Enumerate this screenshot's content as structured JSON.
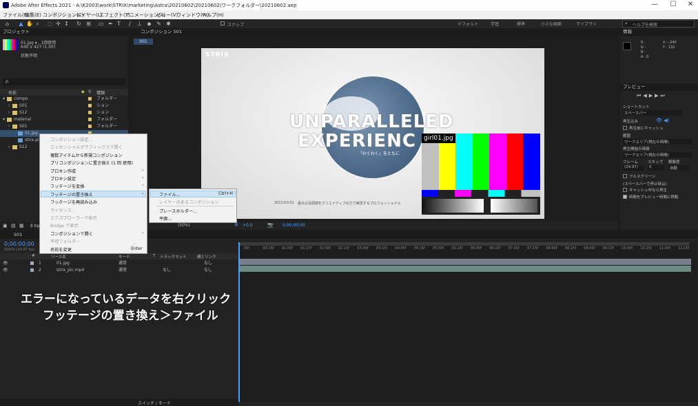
{
  "app": {
    "title": "Adobe After Effects 2021 - A:\\K2003\\work\\STRIX\\marketing\\Astra\\20210602\\20210602\\ワークフォルダー\\20210602.aep"
  },
  "window_controls": {
    "minimize": "—",
    "maximize": "☐",
    "close": "✕"
  },
  "menubar": [
    "ファイル(F)",
    "編集(E)",
    "コンポジション(C)",
    "レイヤー(L)",
    "エフェクト(T)",
    "アニメーション(A)",
    "ビュー(V)",
    "ウィンドウ(W)",
    "ヘルプ(H)"
  ],
  "toolbar": {
    "snap_label": "スナップ",
    "workspaces": [
      "デフォルト",
      "学習",
      "標準",
      "小さな画面",
      "ライブラリ"
    ],
    "search_placeholder": "ヘルプを検索"
  },
  "project_panel": {
    "title": "プロジェクト",
    "preview_name": "01.jpg ▾ , 1回使用",
    "preview_dims": "640 x 427 (1.00)",
    "preview_status": "状態不明",
    "search_placeholder": "ρ.",
    "col_name": "名前",
    "col_type": "種類",
    "items": [
      {
        "name": "compo",
        "type": "フォルダー",
        "depth": 0,
        "color": "#d8c070",
        "expanded": true
      },
      {
        "name": "S01",
        "type": "ション",
        "depth": 1,
        "color": "#d8c070"
      },
      {
        "name": "S12",
        "type": "ション",
        "depth": 1,
        "color": "#d8c070"
      },
      {
        "name": "material",
        "type": "フォルダー",
        "depth": 0,
        "color": "#d8c070",
        "expanded": true
      },
      {
        "name": "S01",
        "type": "フォルダー",
        "depth": 1,
        "color": "#d8c070"
      },
      {
        "name": "01.jpg",
        "type": "",
        "depth": 2,
        "color": "#6aa0d0",
        "selected": true
      },
      {
        "name": "strix.pic",
        "type": "",
        "depth": 2,
        "color": "#6aa0d0"
      },
      {
        "name": "S12",
        "type": "",
        "depth": 1,
        "color": "#d8c070"
      }
    ],
    "bpc": "8 bpc"
  },
  "composition_panel": {
    "tab": "コンポジション S01",
    "breadcrumb": "S01",
    "zoom": "(50%)",
    "time": "0;00;00;00",
    "plus_value": "+0.0"
  },
  "viewer": {
    "brand": "STRIX",
    "headline1": "UNPARALLELED",
    "headline2": "EXPERIENC",
    "subtext": "「わくわく」をともに",
    "date": "2021/03/31",
    "footer_text": "最大の没頭感をクリエイティブの力で実現するプロフェッショナル",
    "missing_label": "girl01.jpg",
    "color_bars": [
      "#c0c0c0",
      "#ffff00",
      "#00ffff",
      "#00ff00",
      "#ff00ff",
      "#ff0000",
      "#0000ff"
    ]
  },
  "context_menu": {
    "items": [
      {
        "label": "コンポジション設定...",
        "enabled": false
      },
      {
        "label": "エッセンシャルグラフィックスで開く",
        "enabled": false
      },
      {
        "label": "複数アイテムから新規コンポジション",
        "enabled": true
      },
      {
        "label": "プリコンポジションに置き換え (1 回 使用)",
        "enabled": true
      },
      {
        "label": "プロキシ作成",
        "enabled": true,
        "submenu": true
      },
      {
        "label": "プロキシ設定",
        "enabled": true,
        "submenu": true
      },
      {
        "label": "フッテージを変換",
        "enabled": true,
        "submenu": true
      },
      {
        "label": "フッテージの置き換え",
        "enabled": true,
        "submenu": true,
        "highlight": true
      },
      {
        "label": "フッテージを再読み込み",
        "enabled": true
      },
      {
        "label": "ライセンス...",
        "enabled": false
      },
      {
        "label": "エクスプローラーで表示",
        "enabled": false
      },
      {
        "label": "Bridge で表示",
        "enabled": false
      },
      {
        "label": "コンポジションで開く",
        "enabled": true,
        "submenu": true
      },
      {
        "label": "平坦フォルダー",
        "enabled": false
      },
      {
        "label": "名前を変更",
        "enabled": true,
        "shortcut": "Enter"
      }
    ]
  },
  "sub_menu": {
    "items": [
      {
        "label": "ファイル...",
        "shortcut": "Ctrl+H",
        "enabled": true,
        "highlight": true
      },
      {
        "label": "レイヤーのあるコンポジション",
        "enabled": false
      },
      {
        "label": "プレースホルダー...",
        "enabled": true
      },
      {
        "label": "平面...",
        "enabled": true
      }
    ]
  },
  "right_panel": {
    "info_title": "情報",
    "info_rgb": [
      "R :",
      "G :",
      "B :",
      "A : 0"
    ],
    "info_xy": [
      "X : -240",
      "Y : 132"
    ],
    "preview_title": "プレビュー",
    "shortcut_label": "ショートカット",
    "shortcut_value": "スペースバー",
    "include_label": "再生込み",
    "cache_label": "再生前にキャッシュ",
    "range_label": "範囲",
    "range_value": "ワークエリア(現在の時間)",
    "play_from_label": "再生開始の時間",
    "play_from_value": "ワークエリア(現在の時間)",
    "frame_rate_label": "フレーム",
    "skip_label": "スキップ",
    "resolution_label": "解像度",
    "frame_rate_value": "(29.97)",
    "skip_value": "0",
    "resolution_value": "自動",
    "fullscreen_label": "フルスクリーン",
    "spacebar_stop_label": "(スペースバーで停止時は)",
    "cache_stop_label": "キャッシュ中なら再生",
    "move_time_label": "時間をプレビュー時間に移動"
  },
  "timeline": {
    "comp_tab": "S01",
    "timecode": "0;00;00;00",
    "timecode_sub": "00000 (29.97 fps)",
    "columns": [
      "#",
      "ソース名",
      "モード",
      "T",
      "トラックマット",
      "親とリンク"
    ],
    "layers": [
      {
        "num": "1",
        "name": "01.jpg",
        "mode": "通常",
        "trkmat": "",
        "parent": "なし"
      },
      {
        "num": "2",
        "name": "strix_pic.mp4",
        "mode": "通常",
        "trkmat": "なし",
        "parent": "なし"
      }
    ],
    "ruler": [
      "00f",
      "00:15f",
      "01:00f",
      "01:15f",
      "02:00f",
      "02:15f",
      "03:00f",
      "03:15f",
      "04:00f",
      "04:15f",
      "05:00f",
      "05:15f",
      "06:00f",
      "06:15f",
      "07:00f",
      "07:15f",
      "08:00f",
      "08:15f",
      "09:00f",
      "09:15f",
      "10:00f",
      "10:15f",
      "11:00f",
      "11:15f"
    ],
    "footer_toggle": "スイッチ / モード"
  },
  "annotation": {
    "line1": "エラーになっているデータを右クリック",
    "line2": "フッテージの置き換え＞ファイル"
  }
}
